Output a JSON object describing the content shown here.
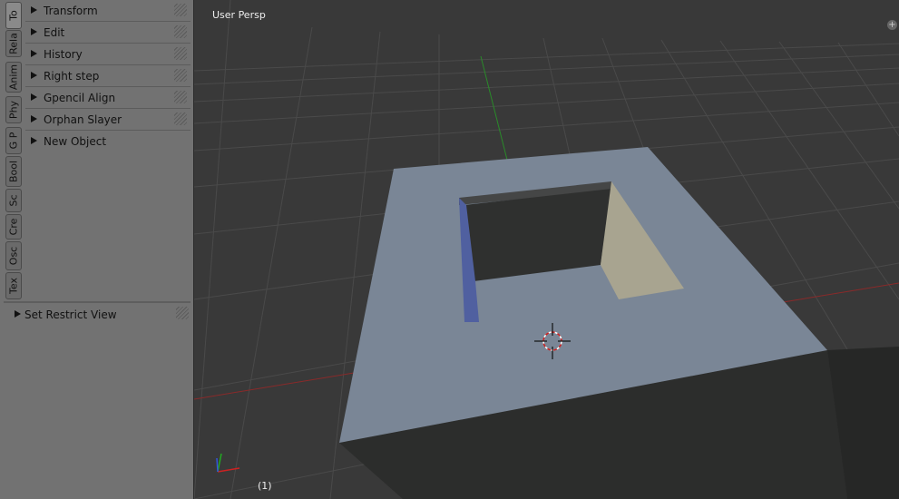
{
  "toolshelf": {
    "tabs": [
      "To",
      "Rela",
      "Anim",
      "Phy",
      "G P",
      "Bool",
      "Sc",
      "Cre",
      "Osc",
      "Tex"
    ],
    "panels": [
      "Transform",
      "Edit",
      "History",
      "Right step",
      "Gpencil Align",
      "Orphan Slayer",
      "New Object"
    ],
    "lower_panel": "Set Restrict View"
  },
  "viewport": {
    "view_label": "User Persp",
    "frame_label": "(1)",
    "corner_widget": "+"
  },
  "colors": {
    "background": "#393939",
    "panel_bg": "#727272",
    "grid": "#4a4a4a",
    "x_axis": "#8a2a2a",
    "y_axis": "#2a8a2a",
    "top_face": "#7a8696",
    "inner_back": "#2f302f",
    "inner_left": "#5060a0",
    "inner_right": "#a8a490",
    "side_face": "#2c2d2c"
  }
}
